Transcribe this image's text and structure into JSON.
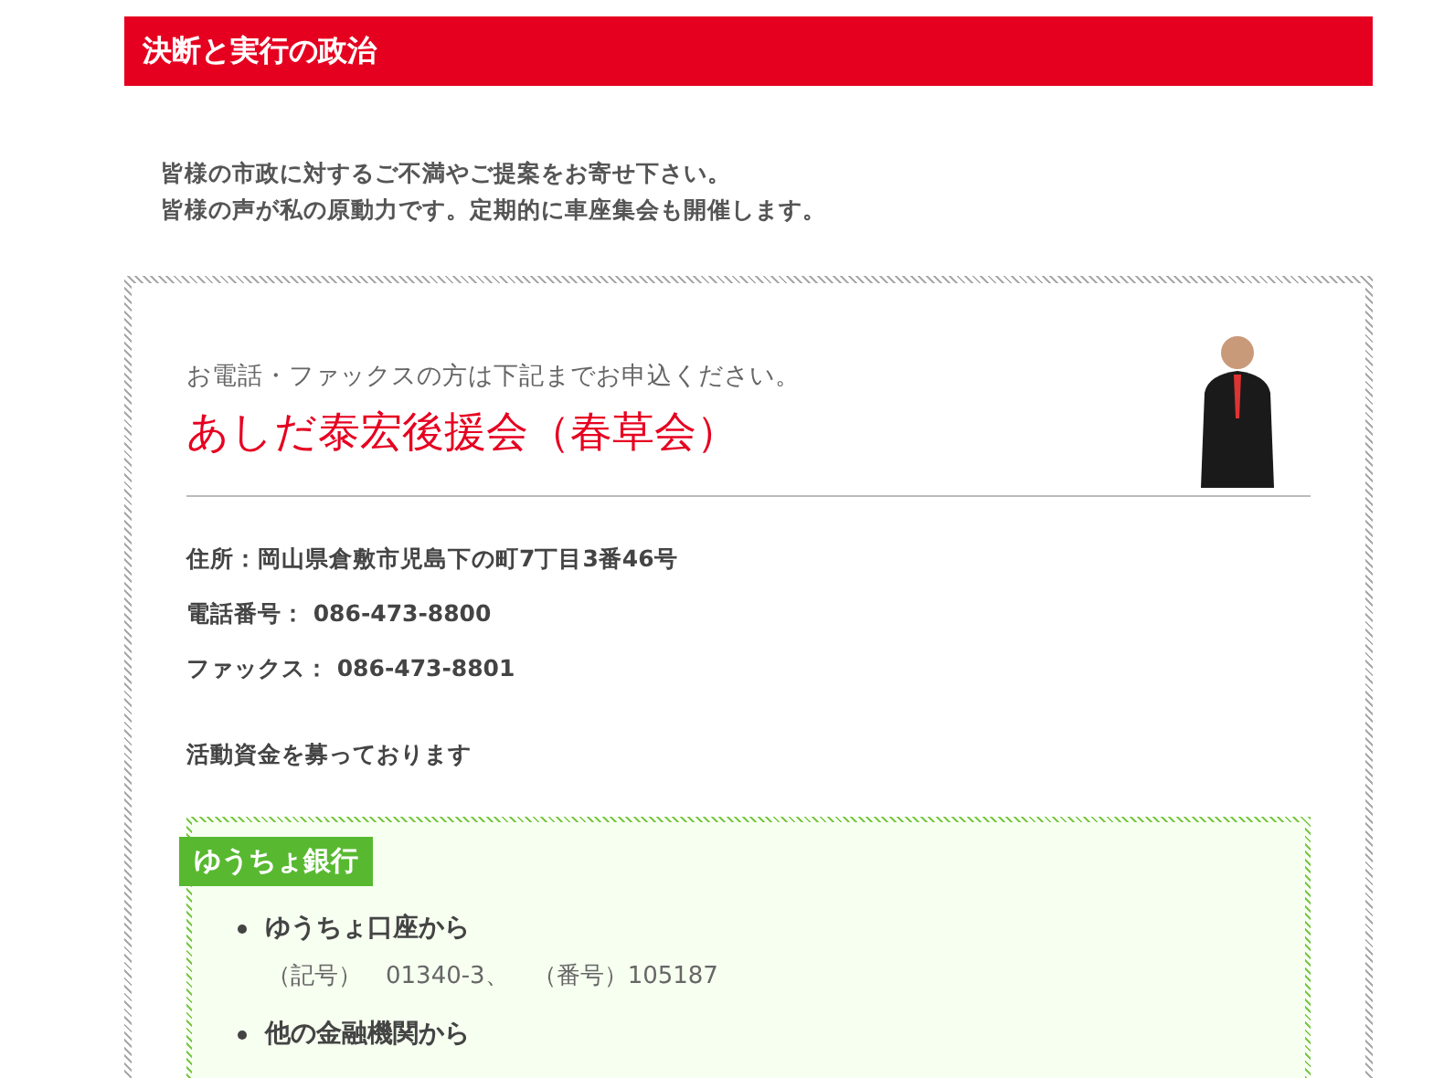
{
  "header": {
    "title": "決断と実行の政治"
  },
  "intro": [
    "皆様の市政に対するご不満やご提案をお寄せ下さい。",
    "皆様の声が私の原動力です。定期的に車座集会も開催します。"
  ],
  "contact": {
    "lead": "お電話・ファックスの方は下記までお申込ください。",
    "name": "あしだ泰宏後援会（春草会）",
    "details": [
      "住所：岡山県倉敷市児島下の町7丁目3番46号",
      "電話番号： 086-473-8800",
      "ファックス： 086-473-8801"
    ],
    "funds_note": "活動資金を募っております",
    "bank": {
      "title": "ゆうちょ銀行",
      "items": [
        {
          "heading": "ゆうちょ口座から",
          "detail": "（記号）　01340-3、　（番号）105187"
        },
        {
          "heading": "他の金融機関から"
        }
      ]
    }
  }
}
